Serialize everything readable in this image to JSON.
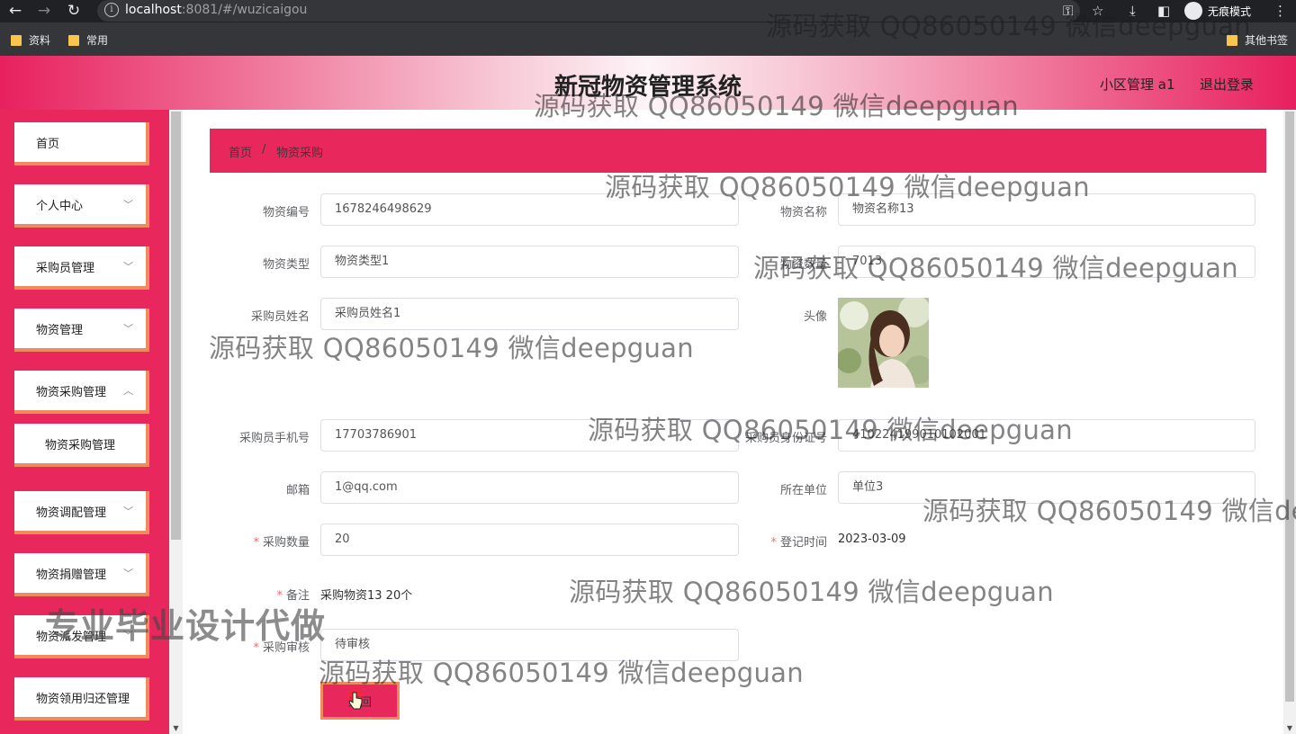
{
  "browser": {
    "url_host": "localhost",
    "url_rest": ":8081/#/wuzicaigou",
    "incognito_label": "无痕模式",
    "bookmarks": [
      "资料",
      "常用"
    ],
    "other_bookmarks": "其他书签"
  },
  "header": {
    "title": "新冠物资管理系统",
    "user": "小区管理 a1",
    "logout": "退出登录"
  },
  "sidebar": {
    "items": [
      {
        "label": "首页"
      },
      {
        "label": "个人中心"
      },
      {
        "label": "采购员管理"
      },
      {
        "label": "物资管理"
      },
      {
        "label": "物资采购管理"
      },
      {
        "label": "物资采购管理"
      },
      {
        "label": "物资调配管理"
      },
      {
        "label": "物资捐赠管理"
      },
      {
        "label": "物资派发管理"
      },
      {
        "label": "物资领用归还管理"
      }
    ]
  },
  "breadcrumb": {
    "home": "首页",
    "sep": "/",
    "current": "物资采购"
  },
  "form": {
    "wuzibianhao": {
      "label": "物资编号",
      "value": "1678246498629"
    },
    "wuzimingcheng": {
      "label": "物资名称",
      "value": "物资名称13"
    },
    "wuzileixing": {
      "label": "物资类型",
      "value": "物资类型1"
    },
    "wuzishuliang": {
      "label": "物资数量",
      "value": "7013"
    },
    "caigouyuanxingming": {
      "label": "采购员姓名",
      "value": "采购员姓名1"
    },
    "touxiang": {
      "label": "头像"
    },
    "shouji": {
      "label": "采购员手机号",
      "value": "17703786901"
    },
    "shenfenzheng": {
      "label": "采购员身份证号",
      "value": "410224199010102001"
    },
    "youxiang": {
      "label": "邮箱",
      "value": "1@qq.com"
    },
    "danwei": {
      "label": "所在单位",
      "value": "单位3"
    },
    "caigoushuliang": {
      "label": "采购数量",
      "value": "20"
    },
    "dengjishijian": {
      "label": "登记时间",
      "value": "2023-03-09"
    },
    "beizhu": {
      "label": "备注",
      "value": "采购物资13 20个"
    },
    "caigoushenhe": {
      "label": "采购审核",
      "value": "待审核"
    },
    "back_button": "返回"
  },
  "watermarks": {
    "repeated": "源码获取 QQ86050149 微信deepguan",
    "big": "专业毕业设计代做"
  }
}
